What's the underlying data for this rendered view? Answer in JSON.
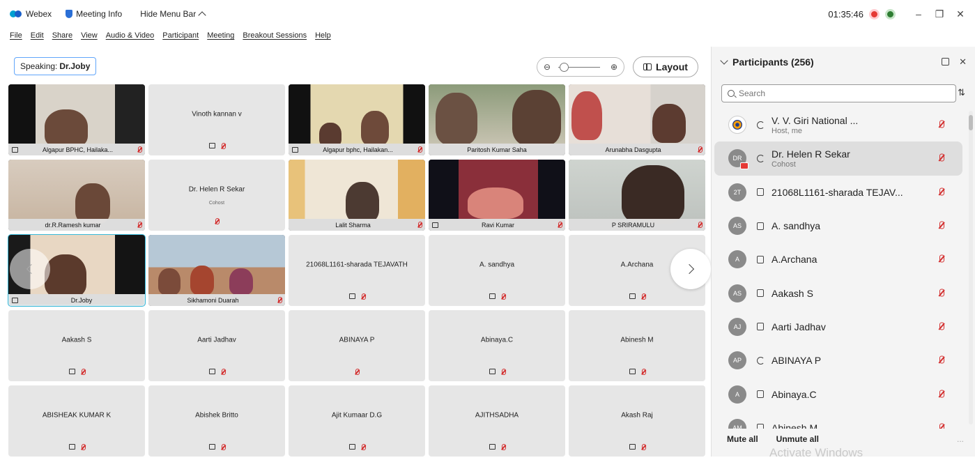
{
  "titlebar": {
    "app_name": "Webex",
    "meeting_info": "Meeting Info",
    "hide_menu": "Hide Menu Bar",
    "timer": "01:35:46"
  },
  "menu": [
    "File",
    "Edit",
    "Share",
    "View",
    "Audio & Video",
    "Participant",
    "Meeting",
    "Breakout Sessions",
    "Help"
  ],
  "toolbar": {
    "speaking_label": "Speaking:",
    "speaking_name": "Dr.Joby",
    "layout_label": "Layout"
  },
  "tiles": [
    {
      "name": "Algapur BPHC, Hailaka...",
      "video": true
    },
    {
      "name": "Vinoth kannan v",
      "video": false
    },
    {
      "name": "Algapur bphc, Hailakan...",
      "video": true
    },
    {
      "name": "Paritosh Kumar Saha",
      "video": true
    },
    {
      "name": "Arunabha Dasgupta",
      "video": true
    },
    {
      "name": "dr.R.Ramesh kumar",
      "video": true
    },
    {
      "name": "Dr. Helen R Sekar",
      "sub": "Cohost",
      "video": false
    },
    {
      "name": "Lalit Sharma",
      "video": true
    },
    {
      "name": "Ravi Kumar",
      "video": true
    },
    {
      "name": "P SRIRAMULU",
      "video": true
    },
    {
      "name": "Dr.Joby",
      "video": true
    },
    {
      "name": "Sikhamoni Duarah",
      "video": true
    },
    {
      "name": "21068L1161-sharada TEJAVATH",
      "video": false
    },
    {
      "name": "A. sandhya",
      "video": false
    },
    {
      "name": "A.Archana",
      "video": false
    },
    {
      "name": "Aakash S",
      "video": false
    },
    {
      "name": "Aarti Jadhav",
      "video": false
    },
    {
      "name": "ABINAYA P",
      "video": false
    },
    {
      "name": "Abinaya.C",
      "video": false
    },
    {
      "name": "Abinesh M",
      "video": false
    },
    {
      "name": "ABISHEAK KUMAR K",
      "video": false
    },
    {
      "name": "Abishek Britto",
      "video": false
    },
    {
      "name": "Ajit Kumaar D.G",
      "video": false
    },
    {
      "name": "AJITHSADHA",
      "video": false
    },
    {
      "name": "Akash Raj",
      "video": false
    }
  ],
  "panel": {
    "title": "Participants (256)",
    "search_placeholder": "Search",
    "participants": [
      {
        "initials": "",
        "name": "V. V. Giri National ...",
        "role": "Host, me",
        "device": "sync"
      },
      {
        "initials": "DR",
        "name": "Dr. Helen R Sekar",
        "role": "Cohost",
        "device": "sync"
      },
      {
        "initials": "2T",
        "name": "21068L1161-sharada TEJAV...",
        "role": "",
        "device": "monitor"
      },
      {
        "initials": "AS",
        "name": "A. sandhya",
        "role": "",
        "device": "monitor"
      },
      {
        "initials": "A",
        "name": "A.Archana",
        "role": "",
        "device": "monitor"
      },
      {
        "initials": "AS",
        "name": "Aakash S",
        "role": "",
        "device": "monitor"
      },
      {
        "initials": "AJ",
        "name": "Aarti Jadhav",
        "role": "",
        "device": "monitor"
      },
      {
        "initials": "AP",
        "name": "ABINAYA P",
        "role": "",
        "device": "sync"
      },
      {
        "initials": "A",
        "name": "Abinaya.C",
        "role": "",
        "device": "monitor"
      },
      {
        "initials": "AM",
        "name": "Abinesh M",
        "role": "",
        "device": "monitor"
      }
    ],
    "mute_all": "Mute all",
    "unmute_all": "Unmute all",
    "more": "..."
  },
  "watermark": "Activate Windows",
  "colors": {
    "active_speaker": "#36b9d9",
    "muted": "#d32f2f",
    "record": "#e53935"
  }
}
